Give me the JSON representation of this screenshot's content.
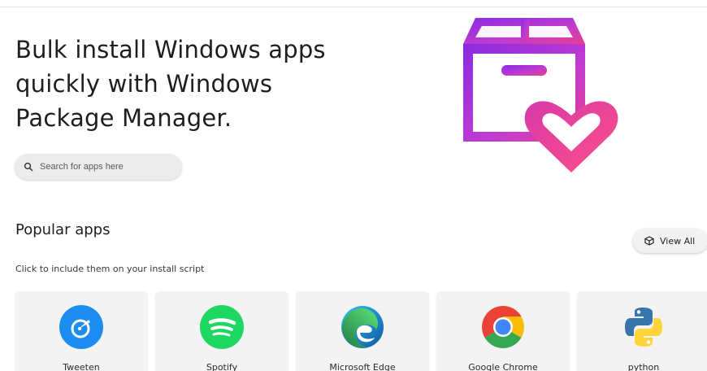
{
  "hero": {
    "title": "Bulk install Windows apps quickly with Windows Package Manager.",
    "art_icon": "package-heart-icon"
  },
  "search": {
    "placeholder": "Search for apps here",
    "value": "",
    "icon": "search-icon"
  },
  "popular": {
    "title": "Popular apps",
    "subtitle": "Click to include them on your install script",
    "view_all_label": "View All",
    "view_all_icon": "package-icon"
  },
  "apps": [
    {
      "name": "Tweeten",
      "icon": "tweeten-icon"
    },
    {
      "name": "Spotify",
      "icon": "spotify-icon"
    },
    {
      "name": "Microsoft Edge",
      "icon": "edge-icon"
    },
    {
      "name": "Google Chrome",
      "icon": "chrome-icon"
    },
    {
      "name": "python",
      "icon": "python-icon"
    }
  ],
  "colors": {
    "accent_pink": "#e83e8c",
    "accent_purple": "#8a2be2",
    "tweeten": "#1d8cf0",
    "spotify": "#1ed760"
  }
}
